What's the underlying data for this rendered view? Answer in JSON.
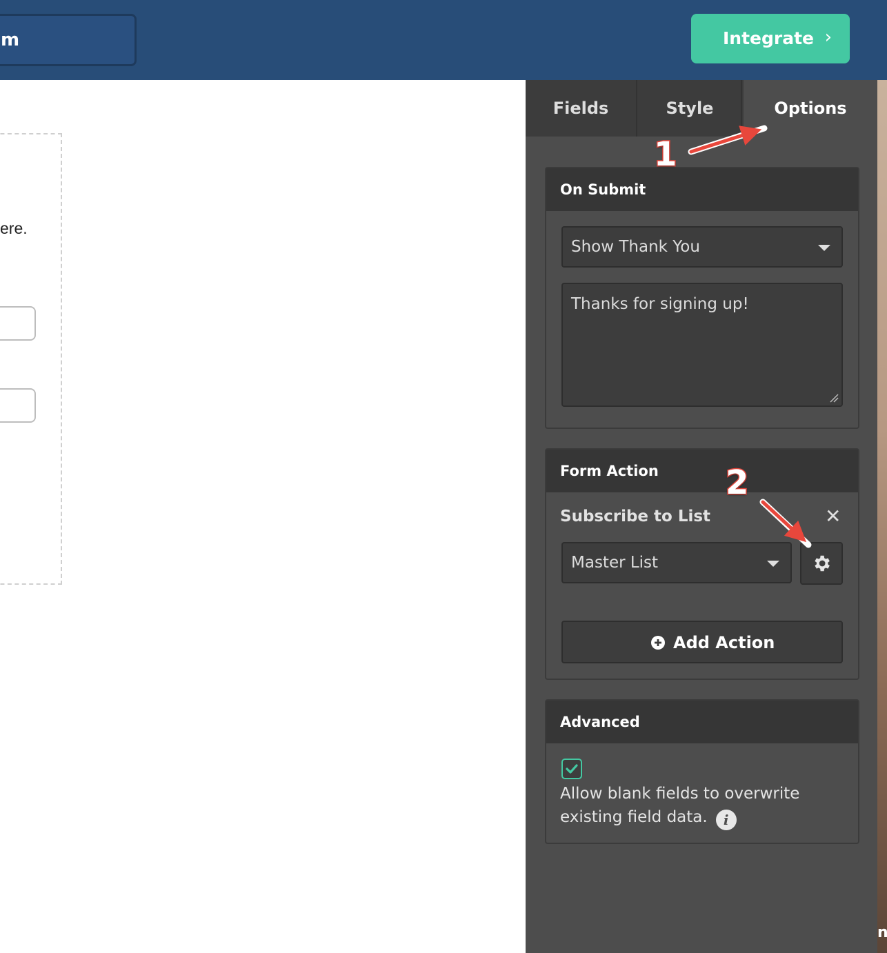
{
  "topbar": {
    "form_name_fragment": "m",
    "integrate_label": "Integrate",
    "integrate_chevron": "›"
  },
  "preview": {
    "text_fragment": "ere."
  },
  "sidebar": {
    "tabs": [
      {
        "label": "Fields",
        "active": false
      },
      {
        "label": "Style",
        "active": false
      },
      {
        "label": "Options",
        "active": true
      }
    ],
    "on_submit": {
      "title": "On Submit",
      "selected": "Show Thank You",
      "message": "Thanks for signing up!"
    },
    "form_action": {
      "title": "Form Action",
      "action_label": "Subscribe to List",
      "close_glyph": "✕",
      "list_selected": "Master List",
      "add_action_label": "Add Action"
    },
    "advanced": {
      "title": "Advanced",
      "checkbox_checked": true,
      "checkbox_label": "Allow blank fields to overwrite existing field data.",
      "info_glyph": "i"
    }
  },
  "annotations": {
    "step1": "1",
    "step2": "2"
  },
  "photo_strip_text": "n)",
  "colors": {
    "topbar": "#284d78",
    "accent": "#44c8a2",
    "sidebar": "#4d4d4d",
    "annotation": "#e8473c"
  }
}
